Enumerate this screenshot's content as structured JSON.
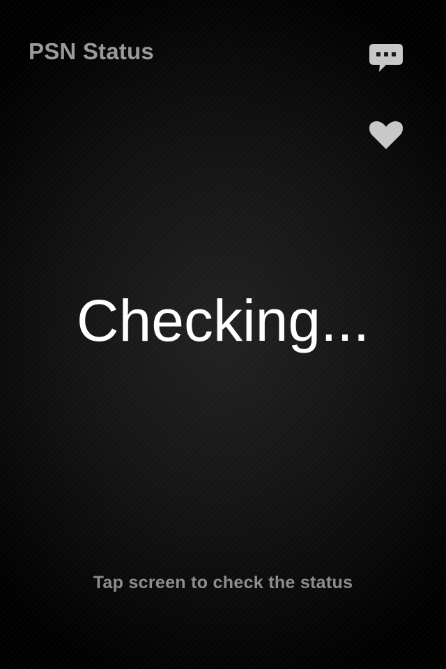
{
  "header": {
    "title": "PSN Status"
  },
  "icons": {
    "feedback": "speech-bubble-icon",
    "favorite": "heart-icon",
    "color": "#c8c8c8"
  },
  "main": {
    "status": "Checking..."
  },
  "footer": {
    "hint": "Tap screen to check the status"
  }
}
